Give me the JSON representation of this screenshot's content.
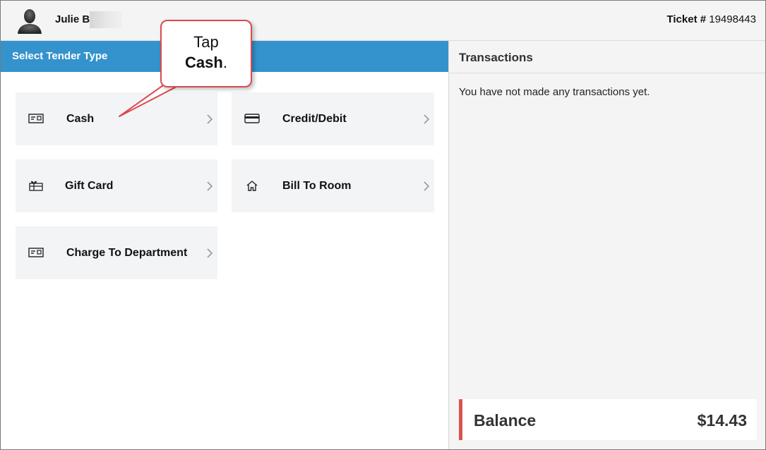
{
  "header": {
    "user_name": "Julie Bu",
    "ticket_label": "Ticket #",
    "ticket_number": "19498443"
  },
  "left_panel": {
    "title": "Select Tender Type",
    "tenders": [
      {
        "label": "Cash",
        "icon": "cash-icon"
      },
      {
        "label": "Credit/Debit",
        "icon": "credit-card-icon"
      },
      {
        "label": "Gift Card",
        "icon": "gift-icon"
      },
      {
        "label": "Bill To Room",
        "icon": "home-icon"
      },
      {
        "label": "Charge To Department",
        "icon": "department-card-icon"
      }
    ]
  },
  "right_panel": {
    "title": "Transactions",
    "empty_message": "You have not made any transactions yet.",
    "balance_label": "Balance",
    "balance_amount": "$14.43"
  },
  "callout": {
    "line1": "Tap",
    "line2_bold": "Cash",
    "line2_suffix": "."
  },
  "colors": {
    "accent_blue": "#3492cc",
    "balance_red": "#d9534f",
    "callout_red": "#d94b50",
    "tile_bg": "#f3f4f6",
    "panel_bg": "#f4f4f5"
  }
}
